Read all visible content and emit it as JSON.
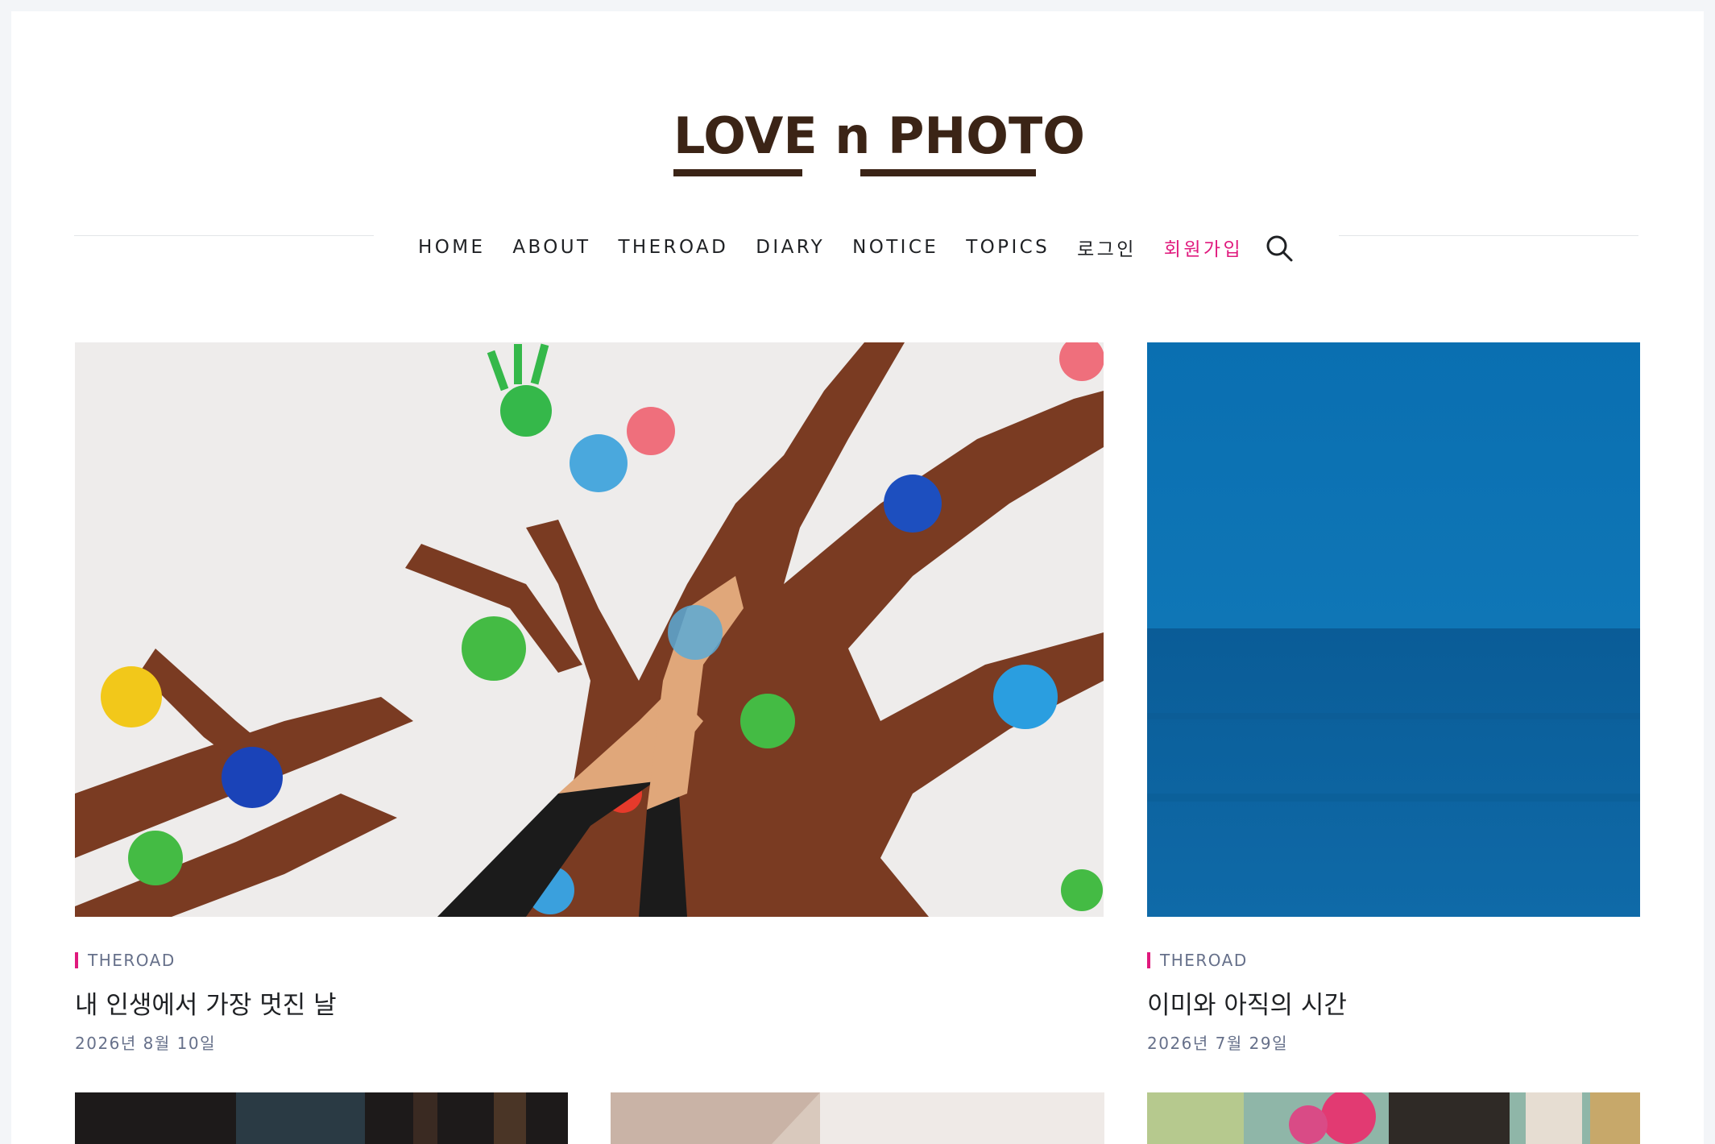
{
  "header": {
    "logo_text": "LOVE n PHOTO",
    "logo_color": "#3b2416"
  },
  "nav": {
    "items": [
      {
        "label": "HOME"
      },
      {
        "label": "ABOUT"
      },
      {
        "label": "THEROAD"
      },
      {
        "label": "DIARY"
      },
      {
        "label": "NOTICE"
      },
      {
        "label": "TOPICS"
      },
      {
        "label": "로그인"
      },
      {
        "label": "회원가입",
        "accent": true
      }
    ],
    "search_icon": "search-icon",
    "accent_color": "#e0197d"
  },
  "posts": [
    {
      "category": "THEROAD",
      "title": "내 인생에서 가장 멋진 날",
      "date": "2026년 8월 10일",
      "image": "handprint-tree-mural"
    },
    {
      "category": "THEROAD",
      "title": "이미와 아직의 시간",
      "date": "2026년 7월 29일",
      "image": "blue-ocean-horizon"
    }
  ],
  "thumbnails": [
    {
      "image": "dark-interior-photo"
    },
    {
      "image": "soft-fabric-photo"
    },
    {
      "image": "flower-shop-photo"
    }
  ]
}
